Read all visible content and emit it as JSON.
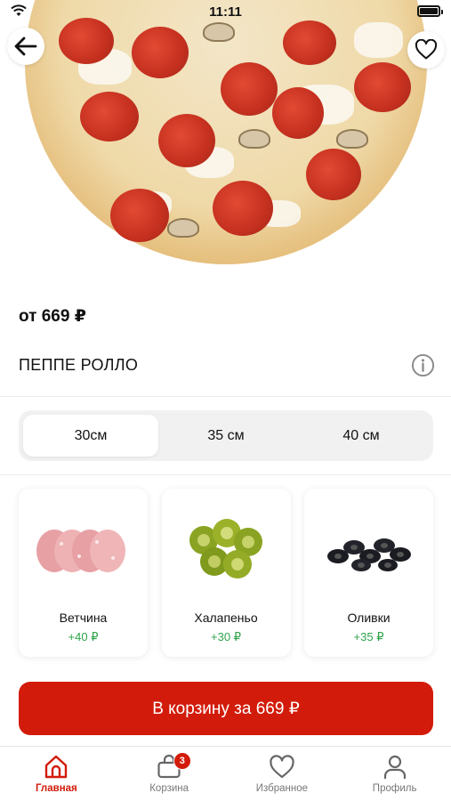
{
  "status_bar": {
    "time": "11:11"
  },
  "product": {
    "price": "от 669 ₽",
    "name": "ПЕППЕ РОЛЛО"
  },
  "sizes": [
    {
      "label": "30см",
      "selected": true
    },
    {
      "label": "35 см",
      "selected": false
    },
    {
      "label": "40 см",
      "selected": false
    }
  ],
  "toppings": [
    {
      "name": "Ветчина",
      "price": "+40 ₽"
    },
    {
      "name": "Халапеньо",
      "price": "+30 ₽"
    },
    {
      "name": "Оливки",
      "price": "+35 ₽"
    }
  ],
  "cta": {
    "label": "В корзину за 669 ₽"
  },
  "tabbar": {
    "items": [
      {
        "label": "Главная",
        "icon": "home-icon",
        "active": true
      },
      {
        "label": "Корзина",
        "icon": "bag-icon",
        "badge": "3"
      },
      {
        "label": "Избранное",
        "icon": "heart-icon"
      },
      {
        "label": "Профиль",
        "icon": "user-icon"
      }
    ]
  },
  "colors": {
    "accent": "#d21b0a",
    "price_green": "#2fa34a"
  }
}
